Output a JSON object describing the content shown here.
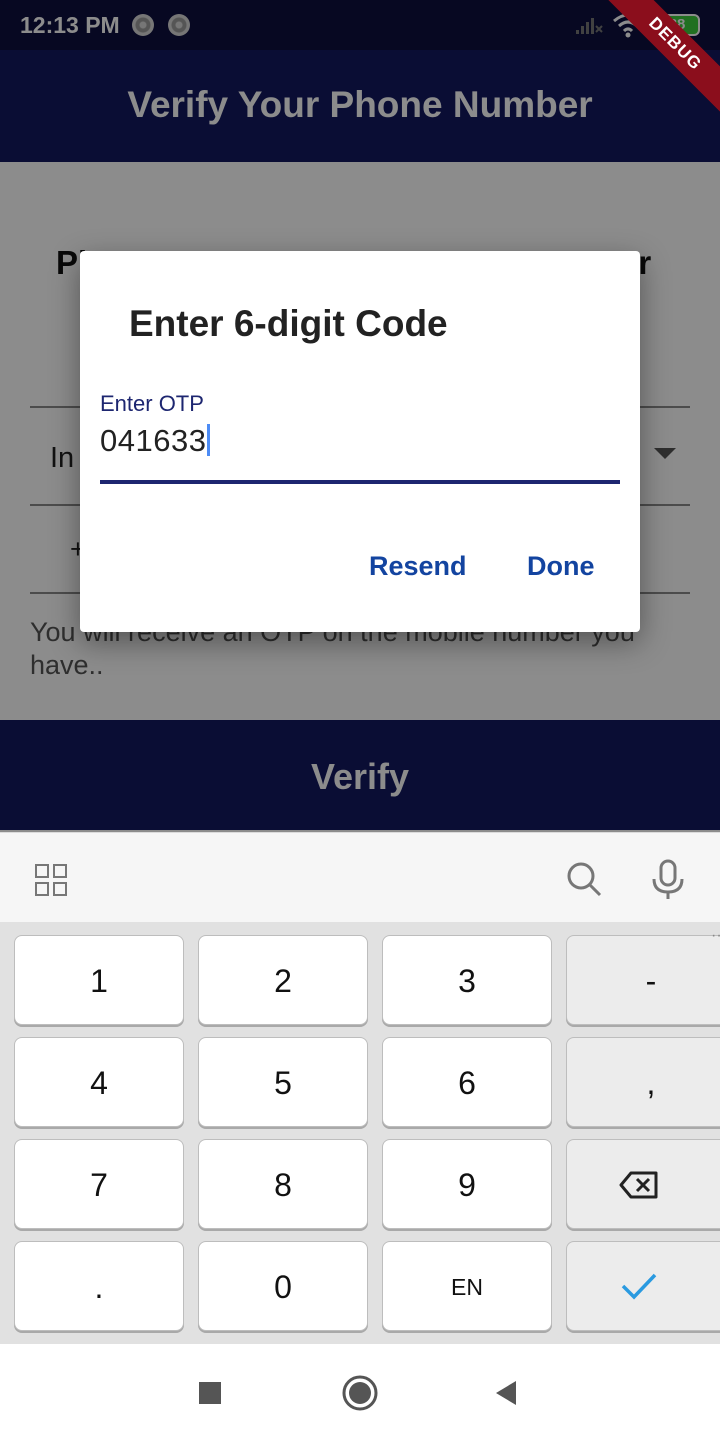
{
  "status_bar": {
    "time": "12:13 PM",
    "battery": "88",
    "debug_label": "DEBUG"
  },
  "app_bar": {
    "title": "Verify Your Phone Number"
  },
  "background_screen": {
    "heading_left": "Pl",
    "heading_right": "er",
    "country_value": "In",
    "phone_prefix": "+",
    "hint": "You will receive an OTP on the mobile number you have..",
    "verify_label": "Verify"
  },
  "dialog": {
    "title": "Enter 6-digit Code",
    "otp_label": "Enter OTP",
    "otp_value": "041633",
    "resend_label": "Resend",
    "done_label": "Done"
  },
  "keyboard": {
    "toolbar_icons": [
      "grid-icon",
      "search-icon",
      "mic-icon"
    ],
    "rows": [
      [
        "1",
        "2",
        "3",
        "-"
      ],
      [
        "4",
        "5",
        "6",
        ","
      ],
      [
        "7",
        "8",
        "9",
        "backspace"
      ],
      [
        ".",
        "0",
        "EN",
        "enter"
      ]
    ],
    "language": "EN",
    "accent_color": "#2a9ae0"
  },
  "nav_bar": {
    "icons": [
      "recents-icon",
      "home-icon",
      "back-icon"
    ]
  },
  "colors": {
    "app_bar": "#131860",
    "dialog_accent": "#1344a0",
    "input_underline": "#1d2670"
  }
}
